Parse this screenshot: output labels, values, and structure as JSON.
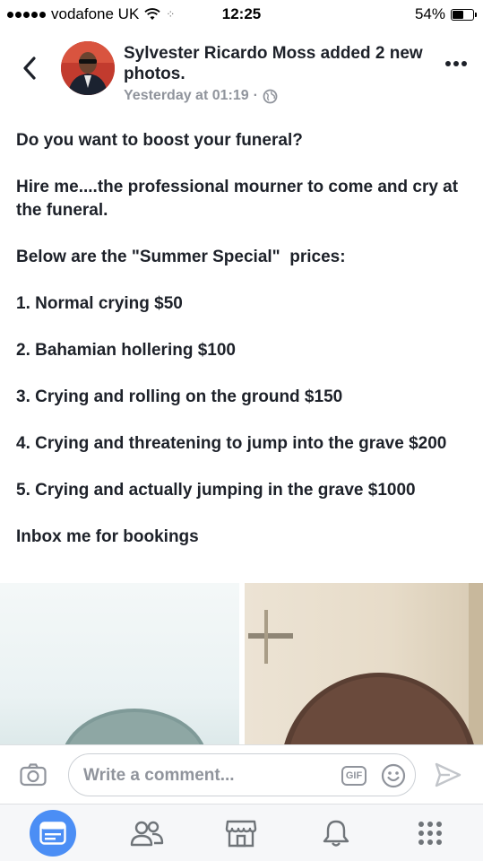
{
  "status_bar": {
    "carrier": "vodafone UK",
    "time": "12:25",
    "battery_percent": "54%",
    "battery_level": 0.54
  },
  "post": {
    "author_text": "Sylvester Ricardo Moss added 2 new photos.",
    "timestamp": "Yesterday at 01:19",
    "separator": "·",
    "privacy_icon": "globe-icon",
    "paragraphs": [
      "Do you want to boost your funeral?",
      "Hire me....the professional mourner to come and cry at the funeral.",
      "Below are the \"Summer Special\"  prices:",
      "1. Normal crying $50",
      "2. Bahamian hollering $100",
      "3. Crying and rolling on the ground $150",
      "4. Crying and threatening to jump into the grave $200",
      "5. Crying and actually jumping in the grave $1000",
      "Inbox me for bookings"
    ]
  },
  "comment_bar": {
    "placeholder": "Write a comment...",
    "gif_label": "GIF"
  },
  "bottom_nav": {
    "items": [
      "news-feed-icon",
      "friends-icon",
      "marketplace-icon",
      "notifications-icon",
      "menu-icon"
    ],
    "active": "news-feed-icon"
  },
  "colors": {
    "accent": "#4b8ef5",
    "text": "#1d2129",
    "secondary": "#90949c"
  }
}
